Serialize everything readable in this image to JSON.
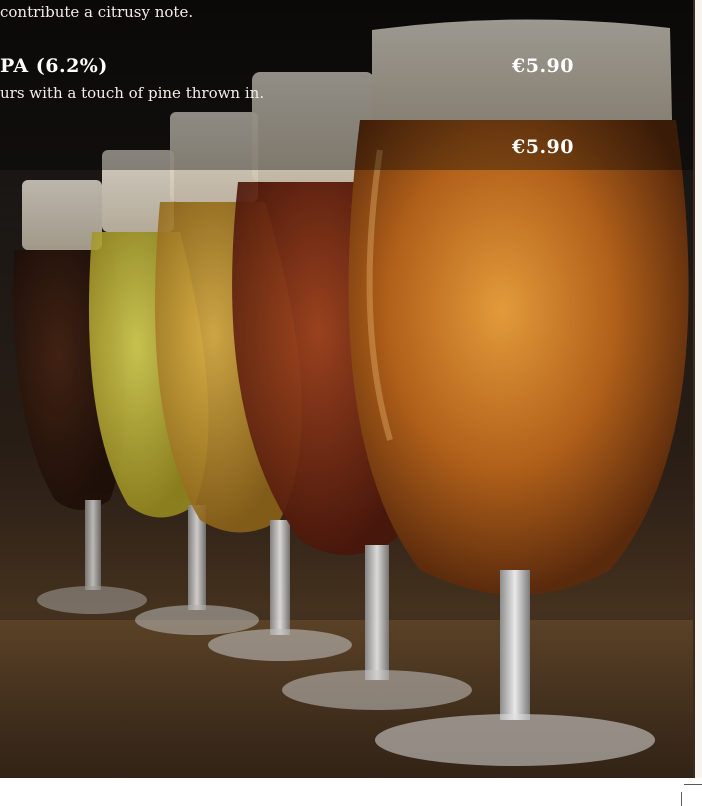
{
  "menu": {
    "items": [
      {
        "description": "contribute a citrusy note."
      },
      {
        "name": "PA (6.2%)",
        "price": "€5.90",
        "description": "urs with a touch of pine thrown in."
      },
      {
        "price": "€5.90"
      }
    ]
  },
  "photo": {
    "subject": "row of beer glasses on bar",
    "colors": {
      "foam": "#e8e1d4",
      "amber": "#c2721b",
      "golden": "#d8b23a",
      "pale": "#d6d34a",
      "red": "#7a2a12",
      "dark": "#2b120a"
    }
  }
}
